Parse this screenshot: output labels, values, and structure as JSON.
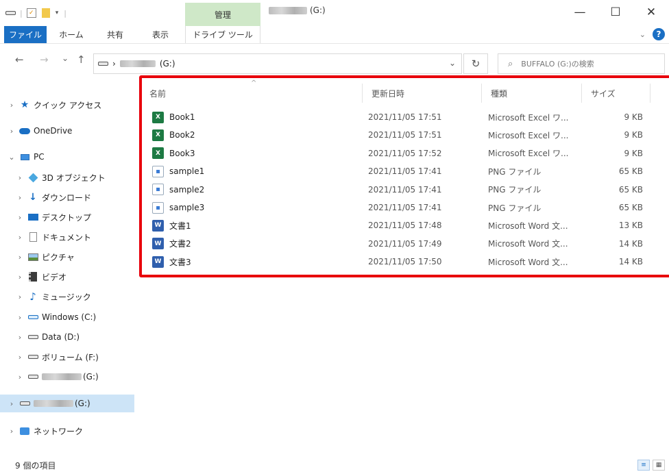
{
  "window": {
    "manage_tab": "管理",
    "drive_letter": "(G:)",
    "minimize": "—",
    "maximize": "☐",
    "close": "✕"
  },
  "ribbon": {
    "tabs": [
      "ファイル",
      "ホーム",
      "共有",
      "表示",
      "ドライブ ツール"
    ],
    "collapse_icon": "chevron-down-icon",
    "help": "?"
  },
  "nav": {
    "back": "←",
    "forward": "→",
    "recent": "⌄",
    "up": "↑",
    "address_sep": "›",
    "address_drive": "(G:)",
    "address_dropdown": "⌄",
    "refresh": "↻",
    "search_placeholder": "BUFFALO (G:)の検索"
  },
  "sidebar": {
    "items": [
      {
        "label": "クイック アクセス",
        "chev": "›",
        "icon": "star-icon"
      },
      {
        "label": "OneDrive",
        "chev": "›",
        "icon": "cloud-icon"
      },
      {
        "label": "PC",
        "chev": "⌄",
        "icon": "pc-icon"
      },
      {
        "label": "3D オブジェクト",
        "chev": "›",
        "icon": "cube-icon"
      },
      {
        "label": "ダウンロード",
        "chev": "›",
        "icon": "download-icon"
      },
      {
        "label": "デスクトップ",
        "chev": "›",
        "icon": "desktop-icon"
      },
      {
        "label": "ドキュメント",
        "chev": "›",
        "icon": "document-icon"
      },
      {
        "label": "ピクチャ",
        "chev": "›",
        "icon": "picture-icon"
      },
      {
        "label": "ビデオ",
        "chev": "›",
        "icon": "video-icon"
      },
      {
        "label": "ミュージック",
        "chev": "›",
        "icon": "music-icon"
      },
      {
        "label": "Windows (C:)",
        "chev": "›",
        "icon": "windows-drive-icon"
      },
      {
        "label": "Data (D:)",
        "chev": "›",
        "icon": "drive-icon"
      },
      {
        "label": "ボリューム (F:)",
        "chev": "›",
        "icon": "drive-icon"
      },
      {
        "label": "(G:)",
        "chev": "›",
        "icon": "drive-icon"
      },
      {
        "label": "(G:)",
        "chev": "›",
        "icon": "drive-icon"
      },
      {
        "label": "ネットワーク",
        "chev": "›",
        "icon": "network-icon"
      }
    ]
  },
  "columns": {
    "name": "名前",
    "date": "更新日時",
    "type": "種類",
    "size": "サイズ",
    "sort_indicator": "^"
  },
  "files": [
    {
      "name": "Book1",
      "date": "2021/11/05 17:51",
      "type": "Microsoft Excel ワ...",
      "size": "9 KB",
      "kind": "excel"
    },
    {
      "name": "Book2",
      "date": "2021/11/05 17:51",
      "type": "Microsoft Excel ワ...",
      "size": "9 KB",
      "kind": "excel"
    },
    {
      "name": "Book3",
      "date": "2021/11/05 17:52",
      "type": "Microsoft Excel ワ...",
      "size": "9 KB",
      "kind": "excel"
    },
    {
      "name": "sample1",
      "date": "2021/11/05 17:41",
      "type": "PNG ファイル",
      "size": "65 KB",
      "kind": "png"
    },
    {
      "name": "sample2",
      "date": "2021/11/05 17:41",
      "type": "PNG ファイル",
      "size": "65 KB",
      "kind": "png"
    },
    {
      "name": "sample3",
      "date": "2021/11/05 17:41",
      "type": "PNG ファイル",
      "size": "65 KB",
      "kind": "png"
    },
    {
      "name": "文書1",
      "date": "2021/11/05 17:48",
      "type": "Microsoft Word 文...",
      "size": "13 KB",
      "kind": "word"
    },
    {
      "name": "文書2",
      "date": "2021/11/05 17:49",
      "type": "Microsoft Word 文...",
      "size": "14 KB",
      "kind": "word"
    },
    {
      "name": "文書3",
      "date": "2021/11/05 17:50",
      "type": "Microsoft Word 文...",
      "size": "14 KB",
      "kind": "word"
    }
  ],
  "file_icon_glyphs": {
    "excel": "X",
    "word": "W",
    "png": "▪"
  },
  "status": {
    "item_count": "9 個の項目"
  },
  "colors": {
    "accent": "#1a6fc4",
    "highlight": "#e8000b",
    "manage_tab": "#cfe8c8",
    "selected": "#cde4f7"
  }
}
